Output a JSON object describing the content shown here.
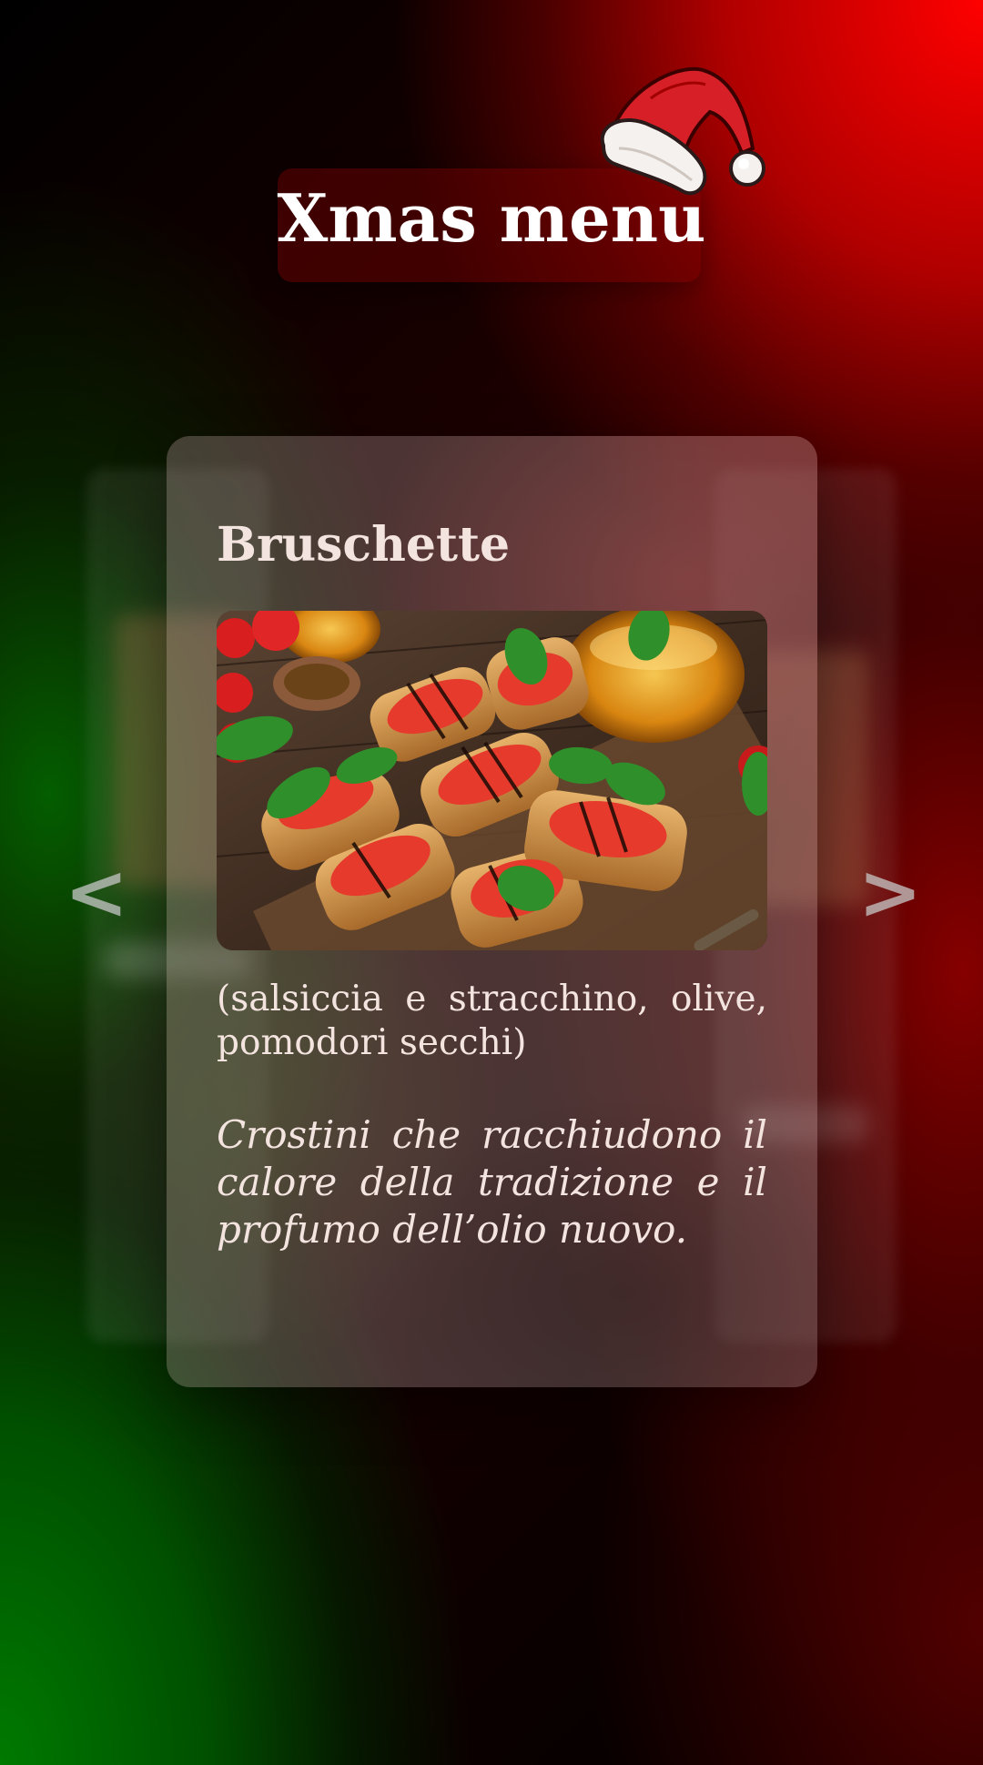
{
  "header": {
    "title": "Xmas menu"
  },
  "carousel": {
    "prev_label": "<",
    "next_label": ">"
  },
  "card": {
    "dish_name": "Bruschette",
    "ingredients": "(salsiccia e stracchino, olive, pomodori secchi)",
    "description": "Crostini che racchiudono il calore della tradizione e il profumo dell’olio nuovo."
  },
  "icons": {
    "hat": "santa-hat-icon",
    "prev": "chevron-left-icon",
    "next": "chevron-right-icon"
  },
  "colors": {
    "accent_red": "#ff0000",
    "accent_green": "#007a00",
    "text_light": "#f3e4e0"
  }
}
